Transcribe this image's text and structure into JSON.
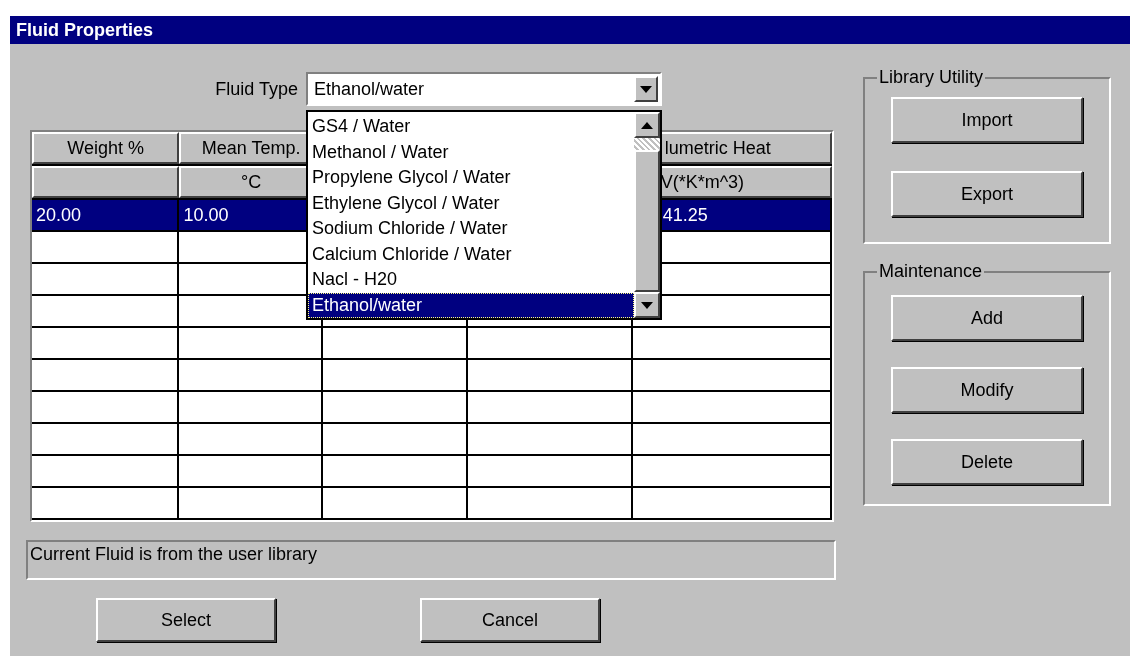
{
  "window": {
    "title": "Fluid Properties"
  },
  "fluid_type": {
    "label": "Fluid Type",
    "value": "Ethanol/water",
    "expanded": true,
    "options": [
      {
        "label": "GS4 / Water",
        "selected": false
      },
      {
        "label": "Methanol / Water",
        "selected": false
      },
      {
        "label": "Propylene Glycol / Water",
        "selected": false
      },
      {
        "label": "Ethylene Glycol / Water",
        "selected": false
      },
      {
        "label": "Sodium Chloride / Water",
        "selected": false
      },
      {
        "label": "Calcium Chloride / Water",
        "selected": false
      },
      {
        "label": "Nacl - H20",
        "selected": false
      },
      {
        "label": "Ethanol/water",
        "selected": true
      }
    ]
  },
  "table": {
    "columns": [
      {
        "label": "Weight %"
      },
      {
        "label": "Mean Temp.",
        "unit": "°C"
      },
      {},
      {},
      {
        "label": "lumetric Heat",
        "unit": "V(*K*m^3)"
      }
    ],
    "rows": [
      {
        "selected": true,
        "cells": [
          "20.00",
          "10.00",
          null,
          null,
          "41.25"
        ]
      },
      {
        "selected": false
      },
      {
        "selected": false
      },
      {
        "selected": false
      },
      {
        "selected": false
      },
      {
        "selected": false
      },
      {
        "selected": false
      },
      {
        "selected": false
      },
      {
        "selected": false
      },
      {
        "selected": false
      }
    ]
  },
  "status": "Current Fluid is from the user library",
  "buttons": [
    "Select",
    "Cancel"
  ],
  "groups": [
    {
      "title": "Library Utility",
      "buttons": [
        "Import",
        "Export"
      ]
    },
    {
      "title": "Maintenance",
      "buttons": [
        "Add",
        "Modify",
        "Delete"
      ]
    }
  ]
}
